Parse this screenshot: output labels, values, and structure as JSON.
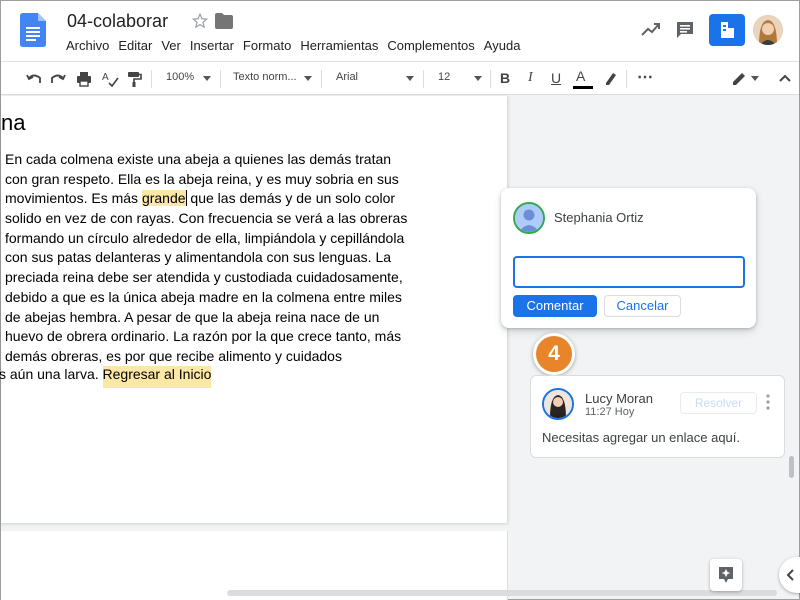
{
  "header": {
    "doc_title": "04-colaborar",
    "menu": [
      "Archivo",
      "Editar",
      "Ver",
      "Insertar",
      "Formato",
      "Herramientas",
      "Complementos",
      "Ayuda"
    ]
  },
  "toolbar": {
    "zoom": "100%",
    "style": "Texto norm...",
    "font": "Arial",
    "font_size": "12",
    "bold": "B",
    "italic": "I",
    "underline": "U",
    "text_color": "A",
    "more": "⋯"
  },
  "document": {
    "heading": "na",
    "lines": [
      "En cada colmena existe una abeja a quienes las demás tratan",
      "con gran respeto. Ella es la abeja reina, y es muy sobria en sus",
      "solido en vez de con rayas. Con frecuencia se verá a las obreras",
      "formando un círculo alrededor de ella, limpiándola y cepillándola",
      "con sus patas delanteras y alimentandola con sus lenguas. La",
      "preciada reina debe ser atendida y custodiada cuidadosamente,",
      "debido a que es la única abeja madre en la colmena entre miles",
      "de abejas hembra. A pesar de que la abeja reina nace de un",
      "huevo de obrera ordinario. La razón por la que crece tanto, más",
      "demás obreras, es por que recibe alimento y cuidados"
    ],
    "line3_pre": "movimientos. Es más ",
    "line3_highlight": "grande",
    "line3_post": " que las demás y de un solo color",
    "last_pre": "s aún una larva. ",
    "last_link": "Regresar al Inicio"
  },
  "new_comment": {
    "author": "Stephania Ortiz",
    "input_value": "",
    "submit_label": "Comentar",
    "cancel_label": "Cancelar"
  },
  "step_badge": "4",
  "existing_comment": {
    "author": "Lucy Moran",
    "time": "11:27 Hoy",
    "resolve_label": "Resolver",
    "text": "Necesitas agregar un enlace aquí."
  },
  "colors": {
    "accent": "#1a73e8",
    "highlight": "#fce8a6",
    "badge": "#e8852b"
  }
}
